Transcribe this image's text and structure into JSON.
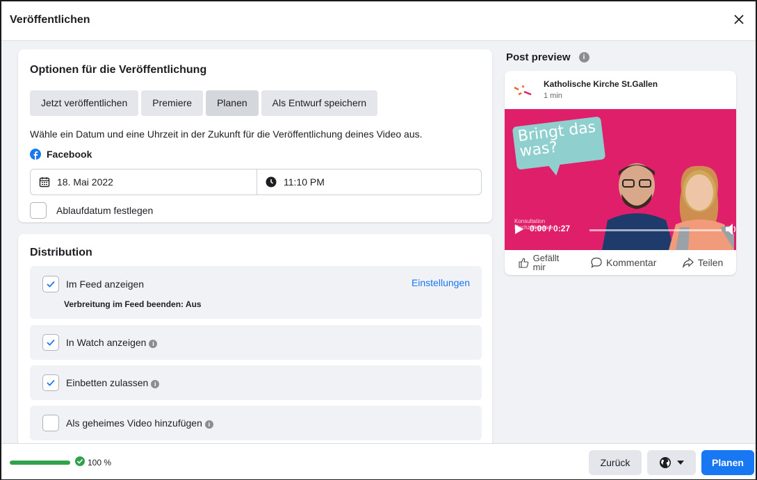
{
  "dialog": {
    "title": "Veröffentlichen"
  },
  "options": {
    "title": "Optionen für die Veröffentlichung",
    "tabs": [
      {
        "label": "Jetzt veröffentlichen"
      },
      {
        "label": "Premiere"
      },
      {
        "label": "Planen",
        "active": true
      },
      {
        "label": "Als Entwurf speichern"
      }
    ],
    "description": "Wähle ein Datum und eine Uhrzeit in der Zukunft für die Veröffentlichung deines Video aus.",
    "platform": "Facebook",
    "date": "18. Mai 2022",
    "time": "11:10 PM",
    "expiry_label": "Ablaufdatum festlegen"
  },
  "distribution": {
    "title": "Distribution",
    "items": [
      {
        "label": "Im Feed anzeigen",
        "checked": true,
        "link": "Einstellungen",
        "sub": "Verbreitung im Feed beenden: Aus"
      },
      {
        "label": "In Watch anzeigen",
        "checked": true
      },
      {
        "label": "Einbetten zulassen",
        "checked": true
      },
      {
        "label": "Als geheimes Video hinzufügen",
        "checked": false
      }
    ]
  },
  "preview": {
    "title": "Post preview",
    "page_name": "Katholische Kirche St.Gallen",
    "time": "1 min",
    "bubble_text": "Bringt das was?",
    "video_small_text": "Konsultation Hochzeitspaare",
    "video_time": "0:00 / 0:27",
    "actions": {
      "like": "Gefällt mir",
      "comment": "Kommentar",
      "share": "Teilen"
    }
  },
  "footer": {
    "progress": 1.0,
    "progress_label": "100 %",
    "back": "Zurück",
    "submit": "Planen"
  },
  "colors": {
    "accent": "#1877f2",
    "success": "#31a24c",
    "video_bg": "#e01f6b",
    "bubble": "#8fd0cf"
  }
}
